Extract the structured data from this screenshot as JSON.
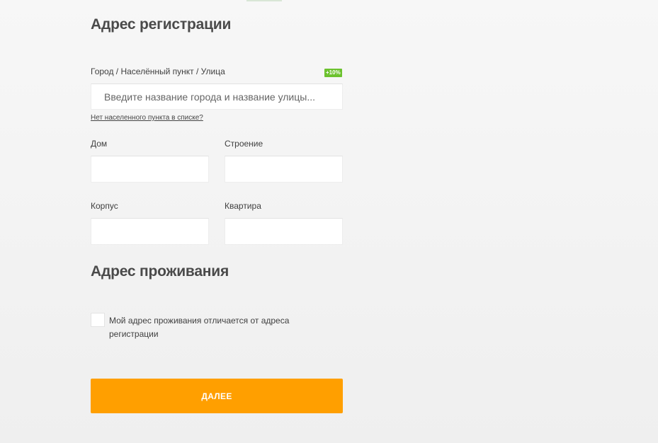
{
  "registration": {
    "title": "Адрес регистрации",
    "city_label": "Город / Населённый пункт / Улица",
    "bonus_badge": "+10%",
    "city_placeholder": "Введите название города и название улицы...",
    "city_value": "",
    "no_city_link": "Нет населенного пункта в списке?",
    "house_label": "Дом",
    "house_value": "",
    "building_label": "Строение",
    "building_value": "",
    "block_label": "Корпус",
    "block_value": "",
    "apartment_label": "Квартира",
    "apartment_value": ""
  },
  "residence": {
    "title": "Адрес проживания",
    "checkbox_label": "Мой адрес проживания отличается от адреса регистрации",
    "checkbox_checked": false
  },
  "actions": {
    "next_label": "ДАЛЕЕ"
  },
  "colors": {
    "accent": "#ff9f00",
    "badge": "#6cc22e",
    "background": "#f2f2f2"
  }
}
